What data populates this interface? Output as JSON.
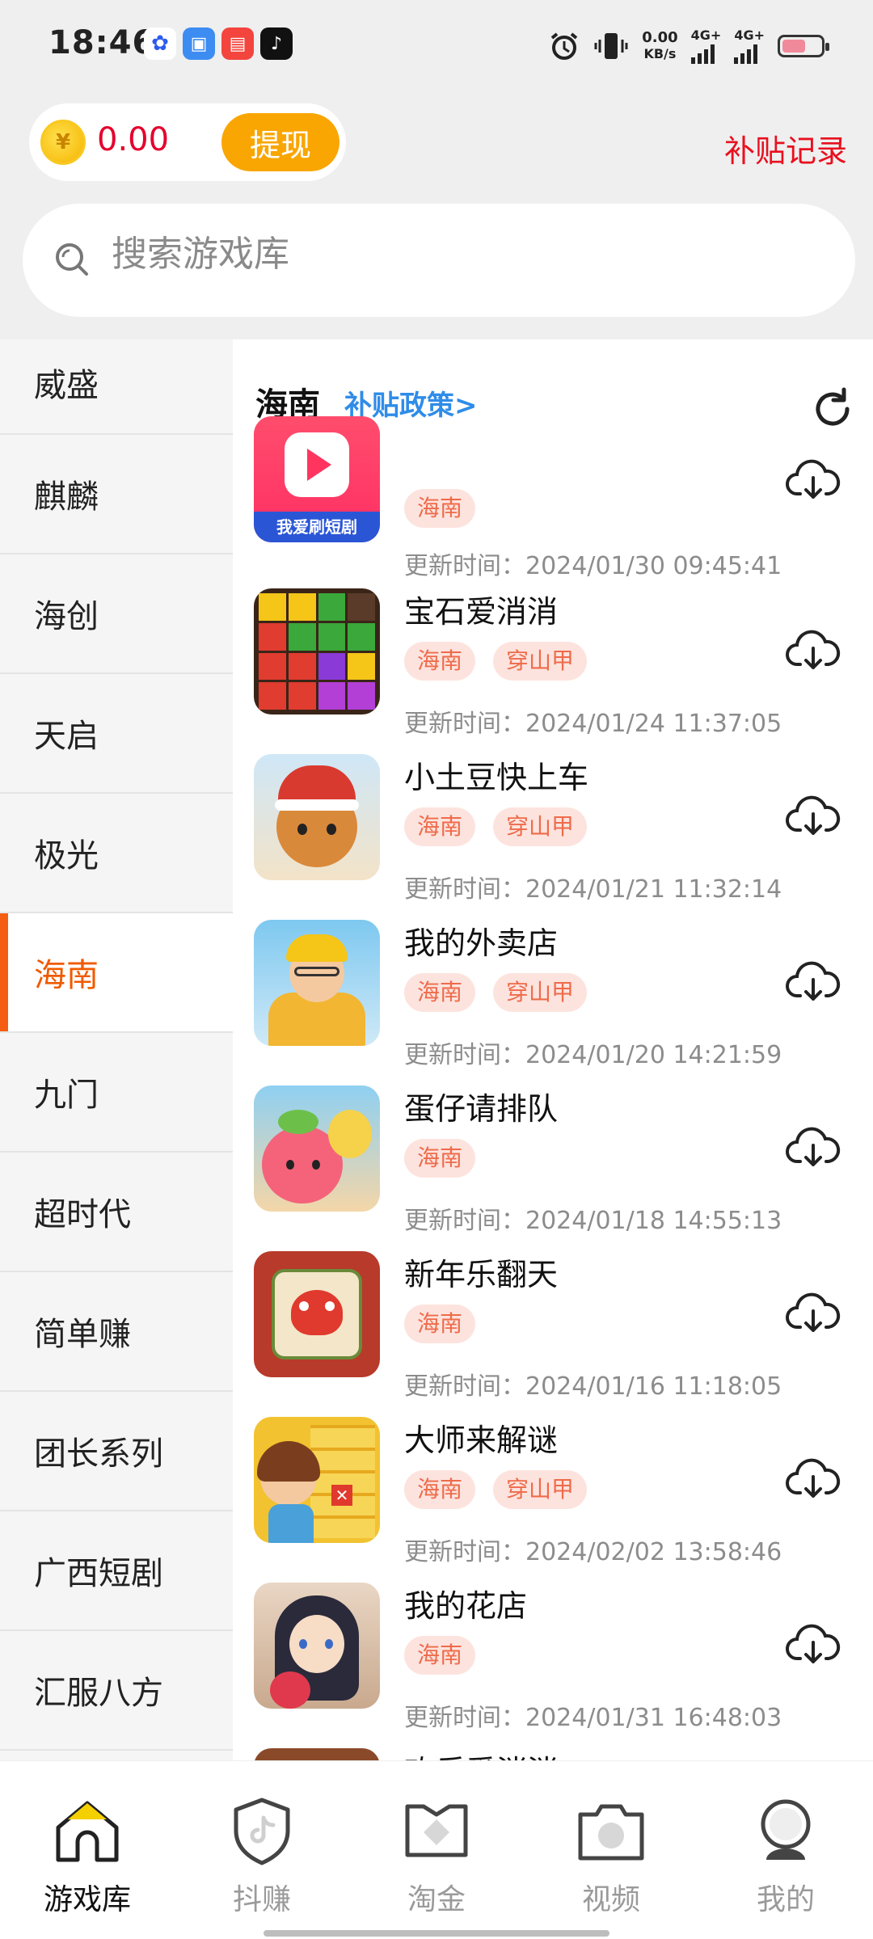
{
  "status_bar": {
    "time": "18:46",
    "net_speed_value": "0.00",
    "net_speed_unit": "KB/s",
    "signal1": "4G+",
    "signal2": "4G+",
    "battery_level": 0.6
  },
  "wallet": {
    "coin_symbol": "¥",
    "amount": "0.00",
    "withdraw_label": "提现"
  },
  "subsidy_record_label": "补贴记录",
  "search": {
    "placeholder": "搜索游戏库"
  },
  "sidebar": {
    "items": [
      {
        "label": "威盛"
      },
      {
        "label": "麒麟"
      },
      {
        "label": "海创"
      },
      {
        "label": "天启"
      },
      {
        "label": "极光"
      },
      {
        "label": "海南"
      },
      {
        "label": "九门"
      },
      {
        "label": "超时代"
      },
      {
        "label": "简单赚"
      },
      {
        "label": "团长系列"
      },
      {
        "label": "广西短剧"
      },
      {
        "label": "汇服八方"
      }
    ],
    "active": "海南"
  },
  "content": {
    "region_title": "海南",
    "policy_link": "补贴政策>",
    "games": [
      {
        "name": "",
        "thumb_text": "我爱刷短剧",
        "tags": [
          "海南"
        ],
        "updated": "更新时间：2024/01/30 09:45:41"
      },
      {
        "name": "宝石爱消消",
        "tags": [
          "海南",
          "穿山甲"
        ],
        "updated": "更新时间：2024/01/24 11:37:05"
      },
      {
        "name": "小土豆快上车",
        "tags": [
          "海南",
          "穿山甲"
        ],
        "updated": "更新时间：2024/01/21 11:32:14"
      },
      {
        "name": "我的外卖店",
        "tags": [
          "海南",
          "穿山甲"
        ],
        "updated": "更新时间：2024/01/20 14:21:59"
      },
      {
        "name": "蛋仔请排队",
        "tags": [
          "海南"
        ],
        "updated": "更新时间：2024/01/18 14:55:13"
      },
      {
        "name": "新年乐翻天",
        "tags": [
          "海南"
        ],
        "updated": "更新时间：2024/01/16 11:18:05"
      },
      {
        "name": "大师来解谜",
        "tags": [
          "海南",
          "穿山甲"
        ],
        "updated": "更新时间：2024/02/02 13:58:46"
      },
      {
        "name": "我的花店",
        "tags": [
          "海南"
        ],
        "updated": "更新时间：2024/01/31 16:48:03"
      },
      {
        "name": "欢乐爱消消",
        "tags": [],
        "updated": ""
      }
    ]
  },
  "bottom_nav": {
    "items": [
      {
        "label": "游戏库",
        "icon": "home-icon"
      },
      {
        "label": "抖赚",
        "icon": "douyin-shield-icon"
      },
      {
        "label": "淘金",
        "icon": "gold-icon"
      },
      {
        "label": "视频",
        "icon": "camera-icon"
      },
      {
        "label": "我的",
        "icon": "profile-icon"
      }
    ],
    "active": "游戏库"
  },
  "colors": {
    "accent_orange": "#f55d12",
    "withdraw_yellow": "#f9a602",
    "red_text": "#e8101f",
    "link_blue": "#2f8ce8",
    "tag_bg": "#fde3de",
    "tag_text": "#ee6b4a"
  }
}
